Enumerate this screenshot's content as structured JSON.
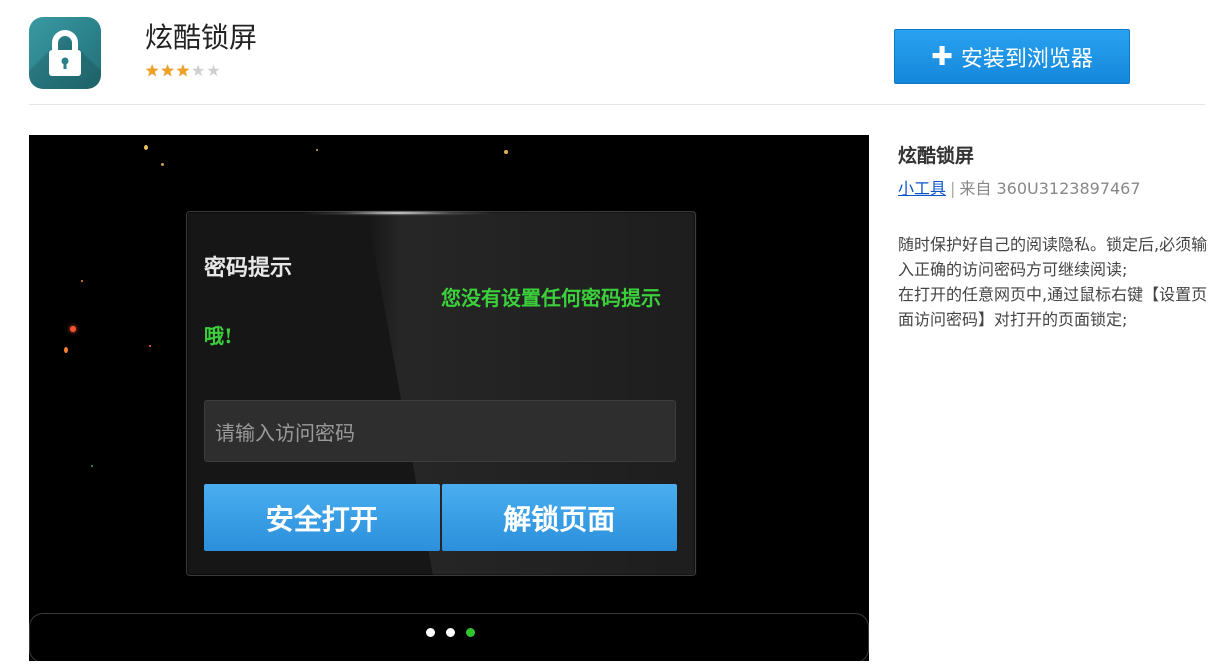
{
  "app": {
    "name": "炫酷锁屏",
    "rating": 3,
    "rating_max": 5,
    "install_label": "安装到浏览器",
    "colors": {
      "accent": "#1a8de0",
      "icon_bg": "#2f8c95"
    }
  },
  "preview": {
    "dialog_title": "密码提示",
    "hint_line1": "您没有设置任何密码提示",
    "hint_line2": "哦!",
    "password_placeholder": "请输入访问密码",
    "btn_open": "安全打开",
    "btn_unlock": "解锁页面",
    "pager_count": 3,
    "pager_active": 3
  },
  "sidebar": {
    "title": "炫酷锁屏",
    "category_link": "小工具",
    "source": "来自 360U3123897467",
    "description": [
      "随时保护好自己的阅读隐私。锁定后,必须输入正确的访问密码方可继续阅读;",
      "在打开的任意网页中,通过鼠标右键【设置页面访问密码】对打开的页面锁定;"
    ]
  }
}
